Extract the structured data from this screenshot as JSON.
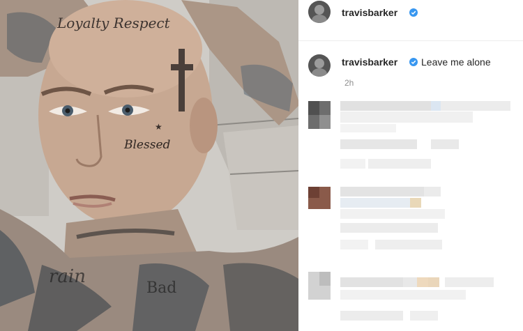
{
  "header": {
    "username": "travisbarker",
    "verified": true
  },
  "caption": {
    "username": "travisbarker",
    "text": "Leave me alone",
    "time": "2h"
  },
  "photo": {
    "forehead_tattoo": "Loyalty Respect",
    "cheek_tattoo": "Blessed",
    "neck_tattoo": "Bad"
  },
  "icons": {
    "verified": "verified-badge-icon"
  },
  "colors": {
    "verified": "#3897f0",
    "text": "#262626",
    "muted": "#8e8e8e"
  }
}
